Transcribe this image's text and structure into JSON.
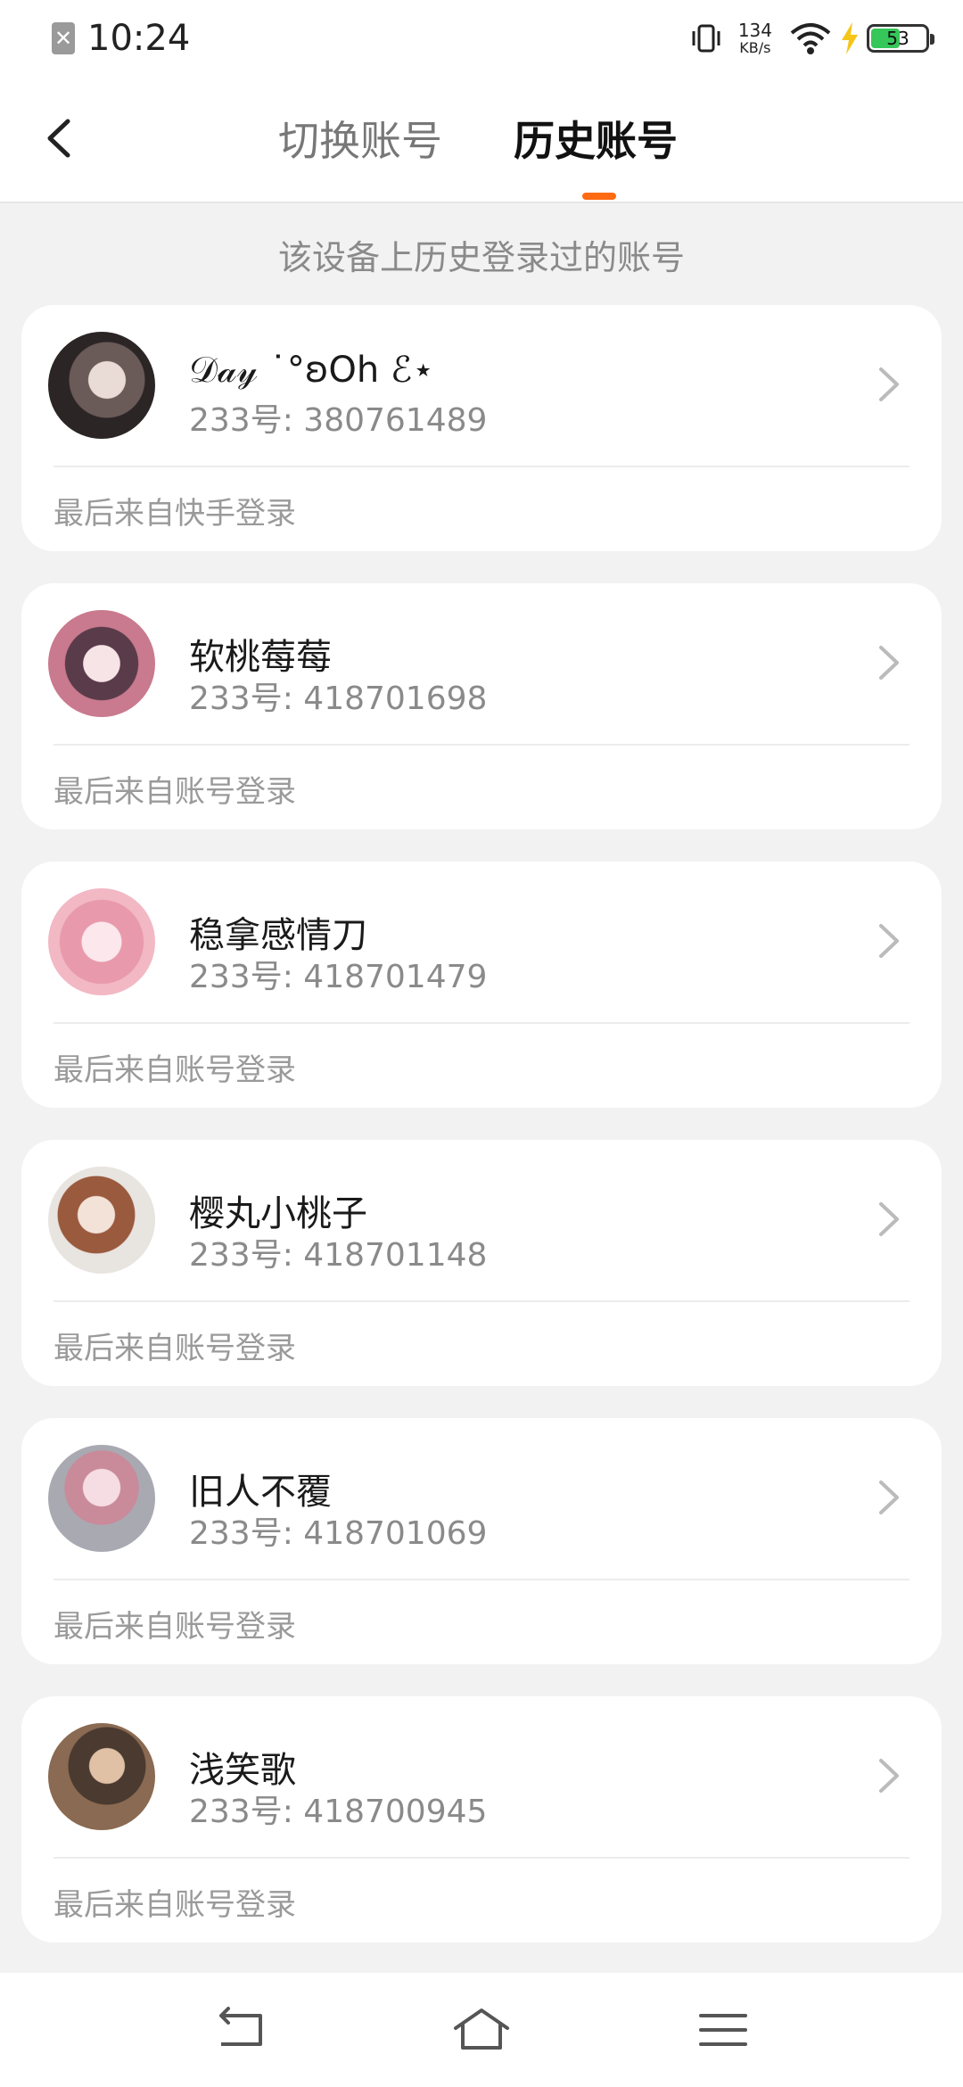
{
  "status_bar": {
    "sim_icon": "sim-error-icon",
    "sim_glyph": "✕",
    "time": "10:24",
    "net_speed_value": "134",
    "net_speed_unit": "KB/s",
    "battery_level": "53",
    "battery_fraction": 0.53,
    "battery_color": "#35c759"
  },
  "header": {
    "tabs": [
      {
        "label": "切换账号",
        "active": false
      },
      {
        "label": "历史账号",
        "active": true
      }
    ],
    "accent_color": "#ff6a13"
  },
  "subtitle": "该设备上历史登录过的账号",
  "accounts": [
    {
      "name": "𝒟𝒶𝓎 ˙°ʚOh ℰ⋆",
      "uid": "233号: 380761489",
      "source": "最后来自快手登录"
    },
    {
      "name": "软桃莓莓",
      "uid": "233号: 418701698",
      "source": "最后来自账号登录"
    },
    {
      "name": "稳拿感情刀",
      "uid": "233号: 418701479",
      "source": "最后来自账号登录"
    },
    {
      "name": "樱丸小桃子",
      "uid": "233号: 418701148",
      "source": "最后来自账号登录"
    },
    {
      "name": "旧人不覆",
      "uid": "233号: 418701069",
      "source": "最后来自账号登录"
    },
    {
      "name": "浅笑歌",
      "uid": "233号: 418700945",
      "source": "最后来自账号登录"
    }
  ],
  "nav_bar": {
    "back": "back-nav-icon",
    "home": "home-nav-icon",
    "menu": "menu-nav-icon"
  }
}
